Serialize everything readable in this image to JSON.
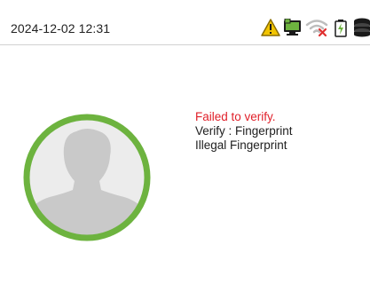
{
  "status_bar": {
    "datetime": "2024-12-02 12:31",
    "icons": [
      "warning-icon",
      "network-icon",
      "wifi-disconnected-icon",
      "battery-charging-icon",
      "storage-icon"
    ]
  },
  "verification": {
    "status": "Failed to verify.",
    "method_line": "Verify : Fingerprint",
    "detail": "Illegal Fingerprint"
  },
  "colors": {
    "avatar_ring": "#6db33f",
    "avatar_fill": "#ececec",
    "silhouette": "#c9c9c9",
    "error_text": "#e0202a",
    "warning": "#f2c400",
    "network": "#6db33f",
    "wifi": "#bdbdbd",
    "wifi_disconnected": "#e03030"
  }
}
